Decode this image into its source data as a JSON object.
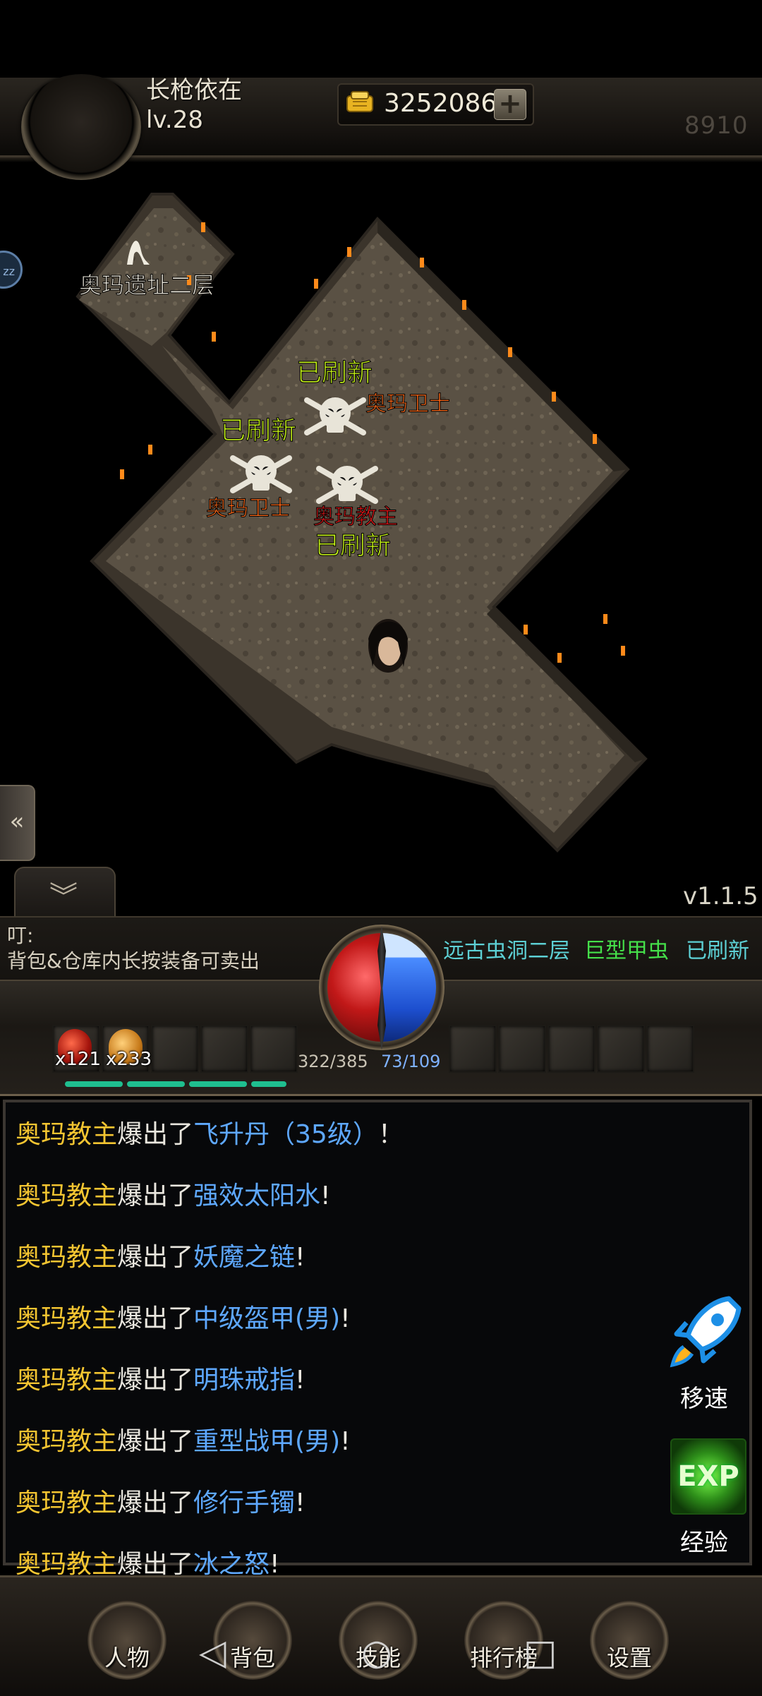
{
  "player": {
    "name": "长枪依在",
    "level": "lv.28"
  },
  "currency": {
    "gold": "3252086",
    "add_symbol": "+"
  },
  "power": "8910",
  "side_badge": "zz",
  "map": {
    "location_name": "奥玛遗址二层",
    "markers": [
      {
        "status": "已刷新",
        "name": "奥玛卫士",
        "name_color": "#ff6a1a"
      },
      {
        "status": "已刷新",
        "name": "奥玛卫士",
        "name_color": "#ff6a1a"
      },
      {
        "status": "已刷新",
        "name": "奥玛教主",
        "name_color": "#e01818"
      }
    ],
    "status_color": "#c4f01a"
  },
  "version": "v1.1.5",
  "notice": {
    "title": "叮:",
    "text": "背包&仓库内长按装备可卖出"
  },
  "event": {
    "location": "远古虫洞二层",
    "monster": "巨型甲虫",
    "status": "已刷新"
  },
  "stats": {
    "hp": "322/385",
    "mp": "73/109"
  },
  "potions": [
    {
      "count": "x121"
    },
    {
      "count": "x233"
    }
  ],
  "chat": [
    {
      "boss": "奥玛教主",
      "verb": "爆出了",
      "item": "飞升丹（35级）",
      "end": "！"
    },
    {
      "boss": "奥玛教主",
      "verb": "爆出了",
      "item": "强效太阳水",
      "end": "!"
    },
    {
      "boss": "奥玛教主",
      "verb": "爆出了",
      "item": "妖魔之链",
      "end": "!"
    },
    {
      "boss": "奥玛教主",
      "verb": "爆出了",
      "item": "中级盔甲(男)",
      "end": "!"
    },
    {
      "boss": "奥玛教主",
      "verb": "爆出了",
      "item": "明珠戒指",
      "end": "!"
    },
    {
      "boss": "奥玛教主",
      "verb": "爆出了",
      "item": "重型战甲(男)",
      "end": "!"
    },
    {
      "boss": "奥玛教主",
      "verb": "爆出了",
      "item": "修行手镯",
      "end": "!"
    },
    {
      "boss": "奥玛教主",
      "verb": "爆出了",
      "item": "冰之怒",
      "end": "!"
    }
  ],
  "side_buttons": {
    "speed": "移速",
    "exp_icon": "EXP",
    "exp": "经验"
  },
  "nav": {
    "character": "人物",
    "bag": "背包",
    "skills": "技能",
    "ranking": "排行榜",
    "settings": "设置"
  },
  "colors": {
    "boss_name": "#f4c531",
    "item_name": "#5ea8ff",
    "event_cyan": "#5dd0d5",
    "event_green": "#45e04a"
  }
}
